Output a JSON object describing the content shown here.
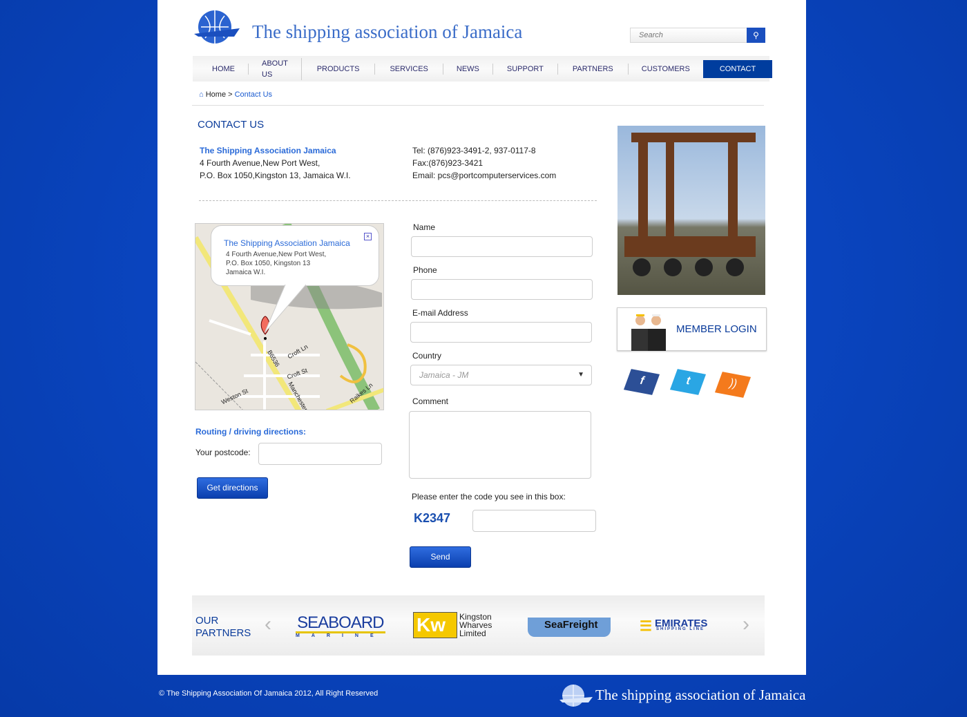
{
  "header": {
    "site_title": "The shipping association of Jamaica",
    "search_placeholder": "Search"
  },
  "nav": [
    "HOME",
    "ABOUT US",
    "PRODUCTS",
    "SERVICES",
    "NEWS",
    "SUPPORT",
    "PARTNERS",
    "CUSTOMERS",
    "CONTACT"
  ],
  "breadcrumb": {
    "home": "Home",
    "sep": " > ",
    "current": "Contact Us"
  },
  "contact": {
    "heading": "CONTACT US",
    "org": "The Shipping Association Jamaica",
    "addr1": "4 Fourth Avenue,New Port West,",
    "addr2": "P.O. Box 1050,Kingston 13, Jamaica W.I.",
    "tel": "Tel: (876)923-3491-2, 937-0117-8",
    "fax": "Fax:(876)923-3421",
    "email": "Email: pcs@portcomputerservices.com"
  },
  "map": {
    "popup_title": "The Shipping Association Jamaica",
    "popup_l1": "4 Fourth Avenue,New Port West,",
    "popup_l2": "P.O. Box 1050, Kingston 13",
    "popup_l3": "Jamaica W.I.",
    "streets": [
      "Croft Ln",
      "Croft St",
      "Weston St",
      "B6536",
      "Manchester",
      "Raikes Ln"
    ]
  },
  "directions": {
    "heading": "Routing / driving directions:",
    "postcode_label": "Your postcode:",
    "button": "Get directions"
  },
  "form": {
    "name": "Name",
    "phone": "Phone",
    "email": "E-mail Address",
    "country": "Country",
    "country_value": "Jamaica - JM",
    "comment": "Comment",
    "captcha_label": "Please enter the code you see in this box:",
    "captcha_code": "K2347",
    "send": "Send"
  },
  "sidebar": {
    "member_login": "MEMBER LOGIN",
    "social": [
      "facebook",
      "twitter",
      "rss"
    ]
  },
  "partners": {
    "heading_l1": "OUR",
    "heading_l2": "PARTNERS",
    "logos": [
      "SEABOARD",
      "MARINE",
      "Kingston",
      "Wharves",
      "Limited",
      "SeaFreight",
      "EMIRATES",
      "SHIPPING LINE"
    ]
  },
  "footer": {
    "copyright": "© The Shipping Association Of Jamaica 2012, All Right Reserved",
    "site_title": "The shipping association of Jamaica"
  }
}
